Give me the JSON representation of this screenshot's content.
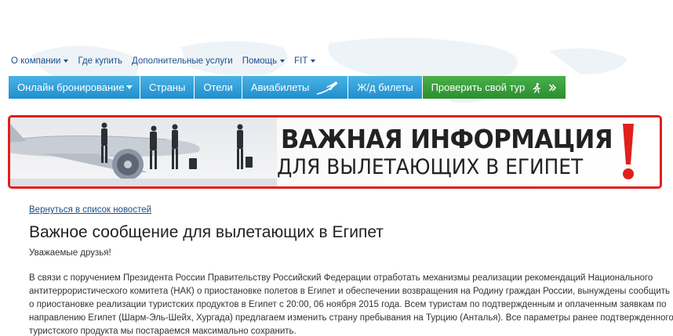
{
  "top_nav": {
    "items": [
      {
        "label": "О компании",
        "dropdown": true
      },
      {
        "label": "Где купить",
        "dropdown": false
      },
      {
        "label": "Дополнительные услуги",
        "dropdown": false
      },
      {
        "label": "Помощь",
        "dropdown": true
      },
      {
        "label": "FIT",
        "dropdown": true
      }
    ]
  },
  "menu": {
    "online_booking": "Онлайн бронирование",
    "countries": "Страны",
    "hotels": "Отели",
    "flights": "Авиабилеты",
    "trains": "Ж/д билеты",
    "check_tour": "Проверить свой тур"
  },
  "banner": {
    "line1": "ВАЖНАЯ ИНФОРМАЦИЯ",
    "line2": "ДЛЯ ВЫЛЕТАЮЩИХ В ЕГИПЕТ",
    "accent_color": "#e0201b"
  },
  "article": {
    "back_link": "Вернуться в список новостей",
    "title": "Важное сообщение для вылетающих в Египет",
    "greeting": "Уважаемые друзья!",
    "paragraph_lines": [
      "В связи с поручением Президента России Правительству Российский Федерации отработать механизмы реализации рекомендаций Национального",
      "антитеррористического комитета (НАК) о приостановке полетов в Египет и обеспечении возвращения на Родину граждан России, вынуждены сообщить",
      "о приостановке реализации туристских продуктов в Египет с 20:00, 06 ноября 2015 года. Всем туристам по подтвержденным и оплаченным заявкам по",
      "направлению Египет (Шарм-Эль-Шейх, Хургада) предлагаем изменить страну пребывания на Турцию (Анталья). Все параметры ранее подтвержденного",
      "туристского продукта мы постараемся максимально сохранить."
    ]
  },
  "colors": {
    "menu_blue": "#1f8fcf",
    "menu_green": "#2c8e2f",
    "link_blue": "#1a4e8a"
  }
}
